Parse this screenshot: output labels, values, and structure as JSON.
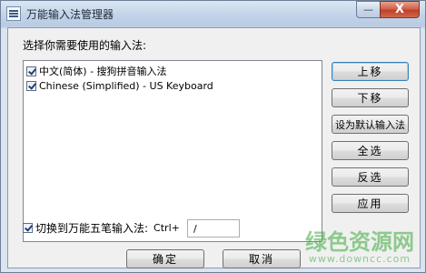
{
  "window": {
    "title": "万能输入法管理器",
    "minimize_symbol": "—",
    "close_symbol": "X"
  },
  "main": {
    "prompt": "选择你需要使用的输入法:",
    "items": [
      {
        "label": "中文(简体) - 搜狗拼音输入法",
        "checked": true
      },
      {
        "label": "Chinese (Simplified) - US Keyboard",
        "checked": true
      }
    ]
  },
  "side_buttons": {
    "move_up": "上移",
    "move_down": "下移",
    "set_default": "设为默认输入法",
    "select_all": "全选",
    "invert_selection": "反选",
    "apply": "应用"
  },
  "shortcut": {
    "checked": true,
    "label": "切换到万能五笔输入法:",
    "prefix": "Ctrl+",
    "value": "/"
  },
  "footer": {
    "ok": "确定",
    "cancel": "取消"
  },
  "watermark": {
    "text": "绿色资源网",
    "url": "www.downcc.com"
  }
}
